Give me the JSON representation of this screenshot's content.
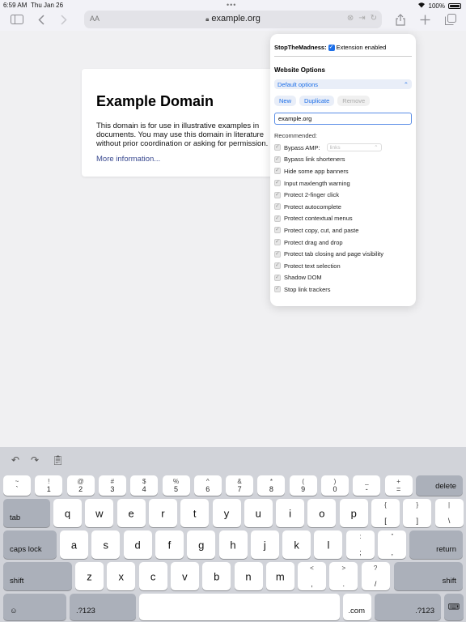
{
  "status": {
    "time": "6:59 AM",
    "date": "Thu Jan 26",
    "battery": "100%"
  },
  "toolbar": {
    "aa": "AA",
    "url": "example.org"
  },
  "page": {
    "title": "Example Domain",
    "body": "This domain is for use in illustrative examples in documents. You may use this domain in literature without prior coordination or asking for permission.",
    "link": "More information..."
  },
  "popover": {
    "extension_name": "StopTheMadness:",
    "extension_enabled": "Extension enabled",
    "section_title": "Website Options",
    "select_value": "Default options",
    "buttons": [
      "New",
      "Duplicate",
      "Remove"
    ],
    "domain_value": "example.org",
    "recommended_label": "Recommended:",
    "amp_select_placeholder": "links",
    "options": [
      "Bypass AMP:",
      "Bypass link shorteners",
      "Hide some app banners",
      "Input maxlength warning",
      "Protect 2-finger click",
      "Protect autocomplete",
      "Protect contextual menus",
      "Protect copy, cut, and paste",
      "Protect drag and drop",
      "Protect tab closing and page visibility",
      "Protect text selection",
      "Shadow DOM",
      "Stop link trackers"
    ]
  },
  "keyboard": {
    "row1": [
      {
        "t": "~",
        "b": "`"
      },
      {
        "t": "!",
        "b": "1"
      },
      {
        "t": "@",
        "b": "2"
      },
      {
        "t": "#",
        "b": "3"
      },
      {
        "t": "$",
        "b": "4"
      },
      {
        "t": "%",
        "b": "5"
      },
      {
        "t": "^",
        "b": "6"
      },
      {
        "t": "&",
        "b": "7"
      },
      {
        "t": "*",
        "b": "8"
      },
      {
        "t": "(",
        "b": "9"
      },
      {
        "t": ")",
        "b": "0"
      },
      {
        "t": "_",
        "b": "-"
      },
      {
        "t": "+",
        "b": "="
      }
    ],
    "delete": "delete",
    "tab": "tab",
    "row2": [
      "q",
      "w",
      "e",
      "r",
      "t",
      "y",
      "u",
      "i",
      "o",
      "p"
    ],
    "row2_sym": [
      {
        "t": "{",
        "b": "["
      },
      {
        "t": "}",
        "b": "]"
      },
      {
        "t": "|",
        "b": "\\"
      }
    ],
    "caps": "caps lock",
    "row3": [
      "a",
      "s",
      "d",
      "f",
      "g",
      "h",
      "j",
      "k",
      "l"
    ],
    "row3_sym": [
      {
        "t": ":",
        "b": ";"
      },
      {
        "t": "”",
        "b": ","
      }
    ],
    "return": "return",
    "shift": "shift",
    "row4": [
      "z",
      "x",
      "c",
      "v",
      "b",
      "n",
      "m"
    ],
    "row4_sym": [
      {
        "t": "<",
        "b": ","
      },
      {
        "t": ">",
        "b": "."
      },
      {
        "t": "?",
        "b": "/"
      }
    ],
    "num": ".?123",
    "com": ".com"
  }
}
